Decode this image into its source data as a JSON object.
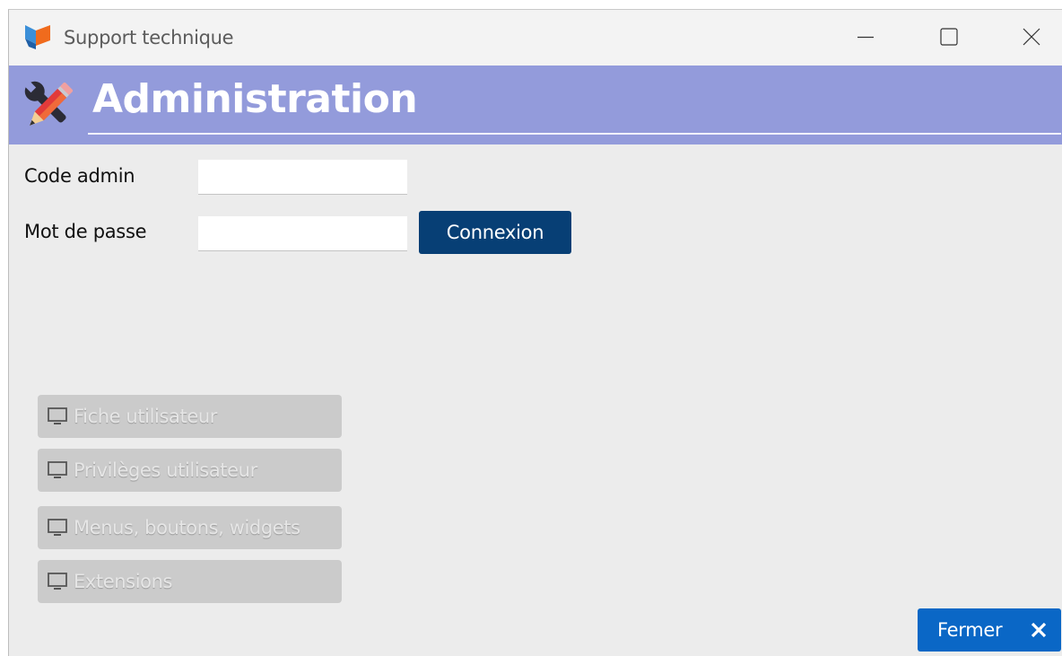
{
  "window": {
    "title": "Support technique",
    "icon": "app-logo-icon"
  },
  "header": {
    "title": "Administration",
    "icon": "tools-icon",
    "background": "#939bdb"
  },
  "form": {
    "code_label": "Code admin",
    "code_value": "",
    "password_label": "Mot de passe",
    "password_value": "",
    "connect_label": "Connexion"
  },
  "menu": {
    "items": [
      {
        "label": "Fiche utilisateur",
        "icon": "monitor-icon",
        "enabled": false
      },
      {
        "label": "Privilèges utilisateur",
        "icon": "monitor-icon",
        "enabled": false
      },
      {
        "label": "Menus, boutons, widgets",
        "icon": "monitor-icon",
        "enabled": false
      },
      {
        "label": "Extensions",
        "icon": "monitor-icon",
        "enabled": false
      }
    ]
  },
  "footer": {
    "close_label": "Fermer",
    "close_icon": "close-x-icon",
    "accent": "#0a67c6"
  },
  "colors": {
    "connect_button": "#073f75",
    "disabled_button": "#cbcbcb"
  }
}
